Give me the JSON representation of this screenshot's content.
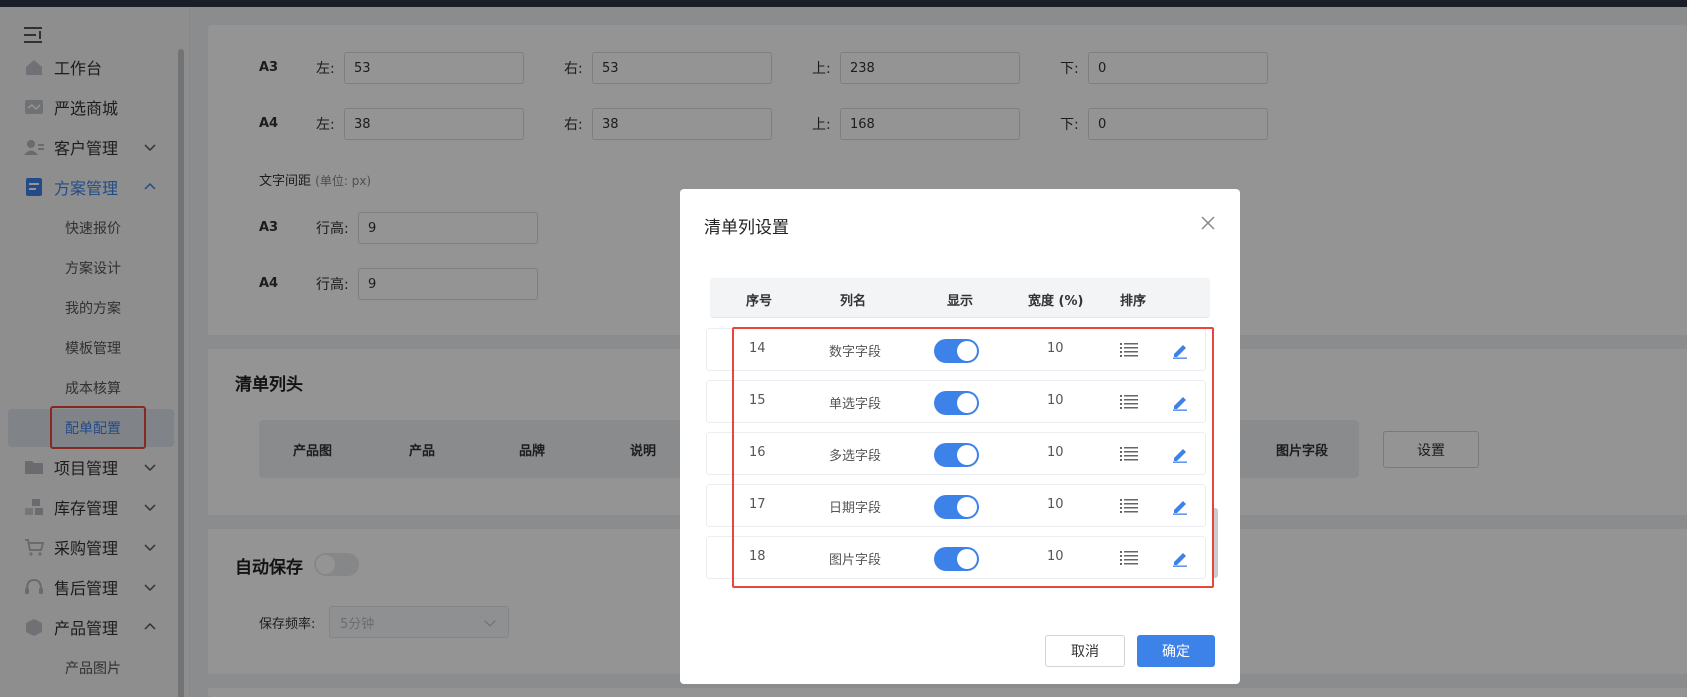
{
  "sidebar": {
    "items": [
      {
        "label": "工作台",
        "icon": "home-icon"
      },
      {
        "label": "严选商城",
        "icon": "store-icon"
      },
      {
        "label": "客户管理",
        "icon": "users-icon"
      },
      {
        "label": "方案管理",
        "icon": "document-icon"
      },
      {
        "label": "项目管理",
        "icon": "folder-icon"
      },
      {
        "label": "库存管理",
        "icon": "inventory-icon"
      },
      {
        "label": "采购管理",
        "icon": "cart-icon"
      },
      {
        "label": "售后管理",
        "icon": "headset-icon"
      },
      {
        "label": "产品管理",
        "icon": "box-icon"
      }
    ],
    "sub_items": [
      "快速报价",
      "方案设计",
      "我的方案",
      "模板管理",
      "成本核算",
      "配单配置"
    ],
    "product_sub_items": [
      "产品图片"
    ],
    "active_color": "#3d82e8"
  },
  "margins": {
    "rows": [
      {
        "label": "A3",
        "left_label": "左:",
        "left": "53",
        "right_label": "右:",
        "right": "53",
        "top_label": "上:",
        "top": "238",
        "bottom_label": "下:",
        "bottom": "0"
      },
      {
        "label": "A4",
        "left_label": "左:",
        "left": "38",
        "right_label": "右:",
        "right": "38",
        "top_label": "上:",
        "top": "168",
        "bottom_label": "下:",
        "bottom": "0"
      }
    ]
  },
  "text_spacing": {
    "title": "文字间距",
    "unit": "(单位: px)",
    "rows": [
      {
        "label": "A3",
        "field_label": "行高:",
        "value": "9"
      },
      {
        "label": "A4",
        "field_label": "行高:",
        "value": "9"
      }
    ]
  },
  "list_header": {
    "title": "清单列头",
    "columns": [
      "产品图",
      "产品",
      "品牌",
      "说明",
      "图片字段"
    ],
    "settings_button": "设置"
  },
  "autosave": {
    "title": "自动保存",
    "enabled": false,
    "freq_label": "保存频率:",
    "freq_value": "5分钟"
  },
  "modal": {
    "title": "清单列设置",
    "headers": {
      "index": "序号",
      "name": "列名",
      "show": "显示",
      "width": "宽度 (%)",
      "sort": "排序"
    },
    "rows": [
      {
        "index": "14",
        "name": "数字字段",
        "shown": true,
        "width": "10"
      },
      {
        "index": "15",
        "name": "单选字段",
        "shown": true,
        "width": "10"
      },
      {
        "index": "16",
        "name": "多选字段",
        "shown": true,
        "width": "10"
      },
      {
        "index": "17",
        "name": "日期字段",
        "shown": true,
        "width": "10"
      },
      {
        "index": "18",
        "name": "图片字段",
        "shown": true,
        "width": "10"
      }
    ],
    "cancel": "取消",
    "confirm": "确定",
    "accent": "#3d82e8",
    "highlight": "#e8463a"
  }
}
